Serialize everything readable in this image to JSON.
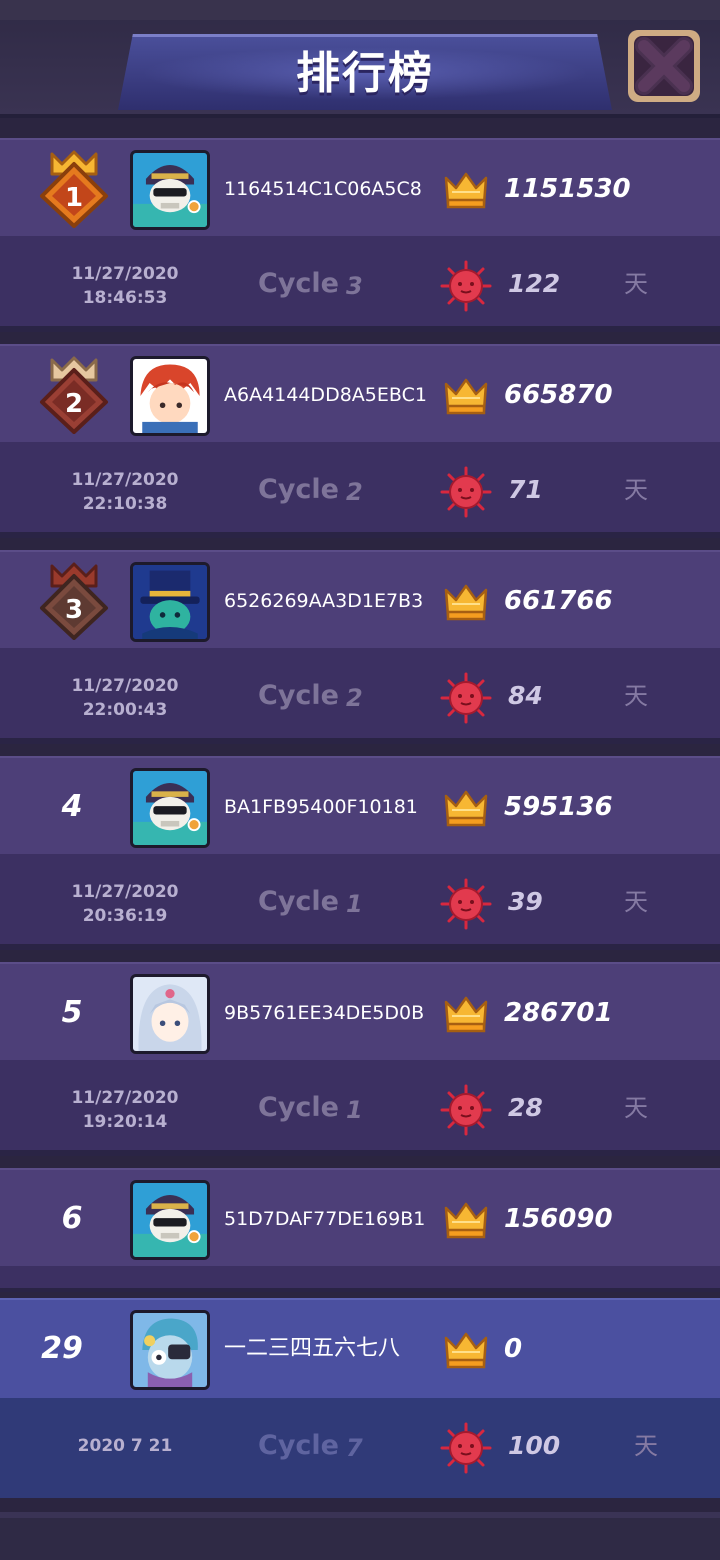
{
  "header": {
    "title": "排行榜",
    "close_icon": "close-x-icon"
  },
  "colors": {
    "crown": "#f7b733",
    "virus": "#e23a4e",
    "row_main": "#4d3f78",
    "row_sub": "#3c3062",
    "highlight_main": "#4b50a0",
    "highlight_sub": "#303a78"
  },
  "cycle_label": "Cycle",
  "day_unit": "天",
  "entries": [
    {
      "rank": "1",
      "medal": "gold",
      "avatar": "skull-pirate",
      "id": "1164514C1C06A5C8",
      "score": "1151530",
      "date": "11/27/2020",
      "time": "18:46:53",
      "cycle": "3",
      "days": "122"
    },
    {
      "rank": "2",
      "medal": "silver",
      "avatar": "red-hair-boy",
      "id": "A6A4144DD8A5EBC1",
      "score": "665870",
      "date": "11/27/2020",
      "time": "22:10:38",
      "cycle": "2",
      "days": "71"
    },
    {
      "rank": "3",
      "medal": "bronze",
      "avatar": "top-hat-mage",
      "id": "6526269AA3D1E7B3",
      "score": "661766",
      "date": "11/27/2020",
      "time": "22:00:43",
      "cycle": "2",
      "days": "84"
    },
    {
      "rank": "4",
      "medal": "",
      "avatar": "skull-pirate",
      "id": "BA1FB95400F10181",
      "score": "595136",
      "date": "11/27/2020",
      "time": "20:36:19",
      "cycle": "1",
      "days": "39"
    },
    {
      "rank": "5",
      "medal": "",
      "avatar": "silver-hair-girl",
      "id": "9B5761EE34DE5D0B",
      "score": "286701",
      "date": "11/27/2020",
      "time": "19:20:14",
      "cycle": "1",
      "days": "28"
    },
    {
      "rank": "6",
      "medal": "",
      "avatar": "skull-pirate",
      "id": "51D7DAF77DE169B1",
      "score": "156090"
    }
  ],
  "me": {
    "rank": "29",
    "avatar": "blue-zombie",
    "id": "一二三四五六七八",
    "score": "0",
    "date": "2020 7 21",
    "cycle": "7",
    "days": "100"
  }
}
